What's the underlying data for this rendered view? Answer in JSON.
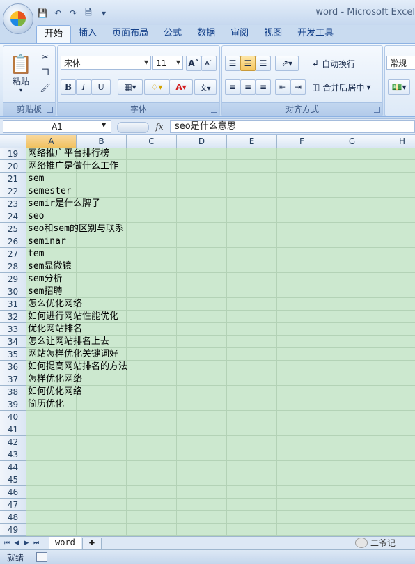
{
  "window": {
    "title": "word - Microsoft Excel"
  },
  "quick_access": [
    "save-icon",
    "undo-icon",
    "redo-icon",
    "print-preview-icon",
    "customize-icon"
  ],
  "ribbon": {
    "tabs": [
      "开始",
      "插入",
      "页面布局",
      "公式",
      "数据",
      "审阅",
      "视图",
      "开发工具"
    ],
    "active_tab": "开始",
    "clipboard": {
      "paste_label": "粘贴",
      "group_label": "剪贴板"
    },
    "font": {
      "name": "宋体",
      "size": "11",
      "bold": "B",
      "italic": "I",
      "underline": "U",
      "group_label": "字体"
    },
    "alignment": {
      "wrap_label": "自动换行",
      "merge_label": "合并后居中",
      "group_label": "对齐方式"
    },
    "number": {
      "format": "常规"
    }
  },
  "formula_bar": {
    "name_box": "A1",
    "fx": "fx",
    "content": "seo是什么意思"
  },
  "columns": [
    "A",
    "B",
    "C",
    "D",
    "E",
    "F",
    "G",
    "H"
  ],
  "selected_column": "A",
  "rows": [
    {
      "num": "19",
      "text": "网络推广平台排行榜"
    },
    {
      "num": "20",
      "text": "网络推广是做什么工作"
    },
    {
      "num": "21",
      "text": "sem"
    },
    {
      "num": "22",
      "text": "semester"
    },
    {
      "num": "23",
      "text": "semir是什么牌子"
    },
    {
      "num": "24",
      "text": "seo"
    },
    {
      "num": "25",
      "text": "seo和sem的区别与联系"
    },
    {
      "num": "26",
      "text": "seminar"
    },
    {
      "num": "27",
      "text": "tem"
    },
    {
      "num": "28",
      "text": "sem显微镜"
    },
    {
      "num": "29",
      "text": "sem分析"
    },
    {
      "num": "30",
      "text": "sem招聘"
    },
    {
      "num": "31",
      "text": "怎么优化网络"
    },
    {
      "num": "32",
      "text": "如何进行网站性能优化"
    },
    {
      "num": "33",
      "text": "优化网站排名"
    },
    {
      "num": "34",
      "text": "怎么让网站排名上去"
    },
    {
      "num": "35",
      "text": "网站怎样优化关键词好"
    },
    {
      "num": "36",
      "text": "如何提高网站排名的方法"
    },
    {
      "num": "37",
      "text": "怎样优化网络"
    },
    {
      "num": "38",
      "text": "如何优化网络"
    },
    {
      "num": "39",
      "text": "简历优化"
    },
    {
      "num": "40",
      "text": ""
    },
    {
      "num": "41",
      "text": ""
    },
    {
      "num": "42",
      "text": ""
    },
    {
      "num": "43",
      "text": ""
    },
    {
      "num": "44",
      "text": ""
    },
    {
      "num": "45",
      "text": ""
    },
    {
      "num": "46",
      "text": ""
    },
    {
      "num": "47",
      "text": ""
    },
    {
      "num": "48",
      "text": ""
    },
    {
      "num": "49",
      "text": ""
    }
  ],
  "sheets": [
    "word"
  ],
  "status": {
    "text": "就绪"
  },
  "watermark": "二爷记",
  "colors": {
    "cell_background": "#cce8cf",
    "selected_header": "#f1c15f",
    "ribbon_accent": "#15428b"
  }
}
